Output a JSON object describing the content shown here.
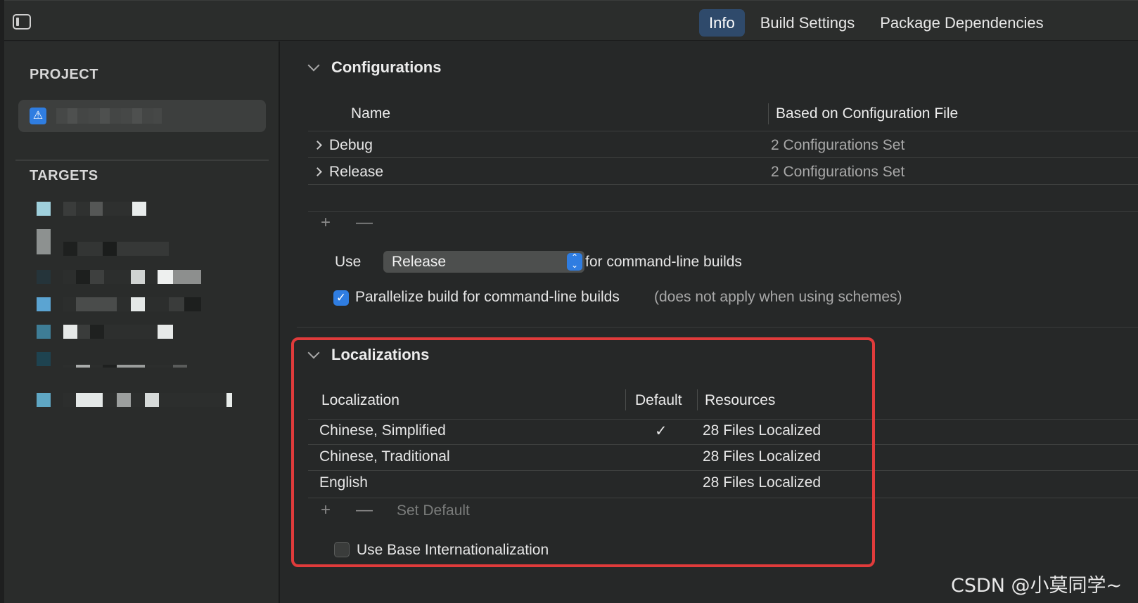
{
  "toolbar": {
    "tabs": [
      {
        "label": "Info",
        "active": true
      },
      {
        "label": "Build Settings",
        "active": false
      },
      {
        "label": "Package Dependencies",
        "active": false
      }
    ]
  },
  "sidebar": {
    "project_heading": "PROJECT",
    "targets_heading": "TARGETS"
  },
  "configurations": {
    "title": "Configurations",
    "columns": [
      "Name",
      "Based on Configuration File"
    ],
    "rows": [
      {
        "name": "Debug",
        "file": "2 Configurations Set"
      },
      {
        "name": "Release",
        "file": "2 Configurations Set"
      }
    ],
    "add_label": "+",
    "remove_label": "—",
    "use_label": "Use",
    "selected_config": "Release",
    "cli_suffix": "for command-line builds",
    "parallelize_label": "Parallelize build for command-line builds",
    "parallelize_note": "(does not apply when using schemes)",
    "parallelize_checked": true
  },
  "localizations": {
    "title": "Localizations",
    "columns": [
      "Localization",
      "Default",
      "Resources"
    ],
    "rows": [
      {
        "name": "Chinese, Simplified",
        "default": "✓",
        "resources": "28 Files Localized"
      },
      {
        "name": "Chinese, Traditional",
        "default": "",
        "resources": "28 Files Localized"
      },
      {
        "name": "English",
        "default": "",
        "resources": "28 Files Localized"
      }
    ],
    "add_label": "+",
    "remove_label": "—",
    "set_default_label": "Set Default",
    "base_intl_label": "Use Base Internationalization",
    "base_intl_checked": false
  },
  "watermark": "CSDN @小莫同学~",
  "colors": {
    "accent": "#2f7de1",
    "active_tab": "#2f4a6b",
    "highlight": "#e03b3b",
    "background": "#262828"
  }
}
